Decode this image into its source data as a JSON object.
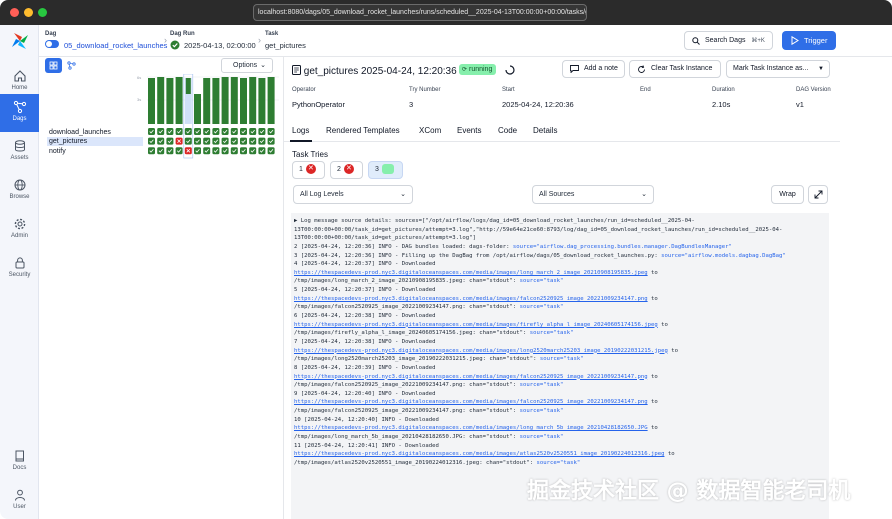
{
  "browser": {
    "url": "localhost:8080/dags/05_download_rocket_launches/runs/scheduled__2025-04-13T00:00:00+00:00/tasks/get_pictu"
  },
  "sidebar": {
    "items": [
      {
        "label": "Home",
        "icon": "home-icon"
      },
      {
        "label": "Dags",
        "icon": "dags-icon"
      },
      {
        "label": "Assets",
        "icon": "assets-icon"
      },
      {
        "label": "Browse",
        "icon": "globe-icon"
      },
      {
        "label": "Admin",
        "icon": "gear-icon"
      },
      {
        "label": "Security",
        "icon": "lock-icon"
      },
      {
        "label": "Docs",
        "icon": "book-icon"
      },
      {
        "label": "User",
        "icon": "user-icon"
      }
    ]
  },
  "breadcrumb": {
    "dag_title": "Dag",
    "dag_value": "05_download_rocket_launches",
    "run_title": "Dag Run",
    "run_value": "2025-04-13, 02:00:00",
    "task_title": "Task",
    "task_value": "get_pictures"
  },
  "header": {
    "search_label": "Search Dags",
    "search_shortcut": "⌘+K",
    "trigger_label": "Trigger"
  },
  "grid": {
    "options_label": "Options",
    "tasks": [
      "download_launches",
      "get_pictures",
      "notify"
    ],
    "selected_task": "get_pictures"
  },
  "task": {
    "title": "get_pictures",
    "datetime": "2025-04-24, 12:20:36",
    "status": "running",
    "add_note": "Add a note",
    "clear": "Clear Task Instance",
    "mark": "Mark Task Instance as..."
  },
  "meta": {
    "labels": [
      "Operator",
      "Try Number",
      "Start",
      "End",
      "Duration",
      "DAG Version"
    ],
    "values": [
      "PythonOperator",
      "3",
      "2025-04-24, 12:20:36",
      "",
      "2.10s",
      "v1"
    ]
  },
  "tabs": [
    "Logs",
    "Rendered Templates",
    "XCom",
    "Events",
    "Code",
    "Details"
  ],
  "tries": {
    "title": "Task Tries",
    "items": [
      "1",
      "2",
      "3"
    ]
  },
  "log_filters": {
    "level": "All Log Levels",
    "sources": "All Sources",
    "wrap": "Wrap"
  },
  "log": {
    "l0": "▶ Log message source details: sources=[\"/opt/airflow/logs/dag_id=05_download_rocket_launches/run_id=scheduled__2025-04-",
    "l1": "13T00:00:00+00:00/task_id=get_pictures/attempt=3.log\",\"http://59e64e21ce60:8793/log/dag_id=05_download_rocket_launches/run_id=scheduled__2025-04-",
    "l2": "13T00:00:00+00:00/task_id=get_pictures/attempt=3.log\"]",
    "l3": "   2  [2025-04-24, 12:20:36] INFO - DAG bundles loaded: dags-folder: ",
    "l3s": "source=\"airflow.dag_processing.bundles.manager.DagBundlesManager\"",
    "l4": "   3  [2025-04-24, 12:20:36] INFO - Filling up the DagBag from /opt/airflow/dags/05_download_rocket_launches.py: ",
    "l4s": "source=\"airflow.models.dagbag.DagBag\"",
    "l5": "   4  [2025-04-24, 12:20:37] INFO - Downloaded",
    "l6u": "https://thespacedevs-prod.nyc3.digitaloceanspaces.com/media/images/long_march_2_image_20210908195835.jpeg",
    "l6": " to",
    "l7": "/tmp/images/long_march_2_image_20210908195835.jpeg: chan=\"stdout\": ",
    "l7s": "source=\"task\"",
    "l8": "   5  [2025-04-24, 12:20:37] INFO - Downloaded",
    "l9u": "https://thespacedevs-prod.nyc3.digitaloceanspaces.com/media/images/falcon2520925_image_20221009234147.png",
    "l9": " to",
    "l10": "/tmp/images/falcon2520925_image_20221009234147.png: chan=\"stdout\": ",
    "l10s": "source=\"task\"",
    "l11": "   6  [2025-04-24, 12:20:38] INFO - Downloaded",
    "l12u": "https://thespacedevs-prod.nyc3.digitaloceanspaces.com/media/images/firefly_alpha_l_image_20240605174156.jpeg",
    "l12": " to",
    "l13": "/tmp/images/firefly_alpha_l_image_20240605174156.jpeg: chan=\"stdout\": ",
    "l13s": "source=\"task\"",
    "l14": "   7  [2025-04-24, 12:20:38] INFO - Downloaded",
    "l15u": "https://thespacedevs-prod.nyc3.digitaloceanspaces.com/media/images/long2520march25203_image_20190222031215.jpeg",
    "l15": " to",
    "l16": "/tmp/images/long2520march25203_image_20190222031215.jpeg: chan=\"stdout\": ",
    "l16s": "source=\"task\"",
    "l17": "   8  [2025-04-24, 12:20:39] INFO - Downloaded",
    "l18u": "https://thespacedevs-prod.nyc3.digitaloceanspaces.com/media/images/falcon2520925_image_20221009234147.png",
    "l18": " to",
    "l19": "/tmp/images/falcon2520925_image_20221009234147.png: chan=\"stdout\": ",
    "l19s": "source=\"task\"",
    "l20": "   9  [2025-04-24, 12:20:40] INFO - Downloaded",
    "l21u": "https://thespacedevs-prod.nyc3.digitaloceanspaces.com/media/images/falcon2520925_image_20221009234147.png",
    "l21": " to",
    "l22": "/tmp/images/falcon2520925_image_20221009234147.png: chan=\"stdout\": ",
    "l22s": "source=\"task\"",
    "l23": "  10  [2025-04-24, 12:20:40] INFO - Downloaded",
    "l24u": "https://thespacedevs-prod.nyc3.digitaloceanspaces.com/media/images/long_march_5b_image_20210428182650.JPG",
    "l24": " to",
    "l25": "/tmp/images/long_march_5b_image_20210428182650.JPG: chan=\"stdout\": ",
    "l25s": "source=\"task\"",
    "l26": "  11  [2025-04-24, 12:20:41] INFO - Downloaded",
    "l27u": "https://thespacedevs-prod.nyc3.digitaloceanspaces.com/media/images/atlas2520v2520551_image_20190224012316.jpeg",
    "l27": " to",
    "l28": "/tmp/images/atlas2520v2520551_image_20190224012316.jpeg: chan=\"stdout\": ",
    "l28s": "source=\"task\""
  },
  "watermark": "掘金技术社区 @ 数据智能老司机",
  "colors": {
    "accent": "#2f6ee7",
    "success": "#2e7d32",
    "running": "#86efac",
    "failed": "#dc2626"
  }
}
